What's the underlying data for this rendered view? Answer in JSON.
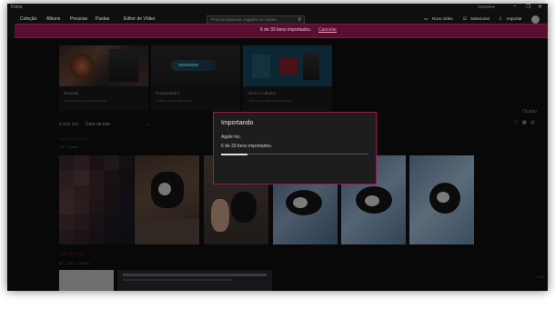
{
  "app": {
    "title": "Fotos",
    "onedrive": "OneDrive"
  },
  "window_controls": {
    "minimize": "–",
    "maximize": "❐",
    "close": "✕"
  },
  "nav": {
    "items": [
      "Coleção",
      "Álbuns",
      "Pessoas",
      "Pastas",
      "Editor de Vídeo"
    ]
  },
  "search": {
    "placeholder": "Procure pessoas, lugares ou coisas..."
  },
  "commands": {
    "new_video": "Novo vídeo",
    "select": "Selecionar",
    "import": "Importar"
  },
  "banner": {
    "text": "6 de 33 itens importados.",
    "link": "Cancelar"
  },
  "cards": [
    {
      "title": "Recente",
      "subtitle": "Adicionado na sua coleção"
    },
    {
      "title": "#computador",
      "subtitle": "Vídeos automatizados"
    },
    {
      "title": "Você é o diretor",
      "subtitle": "Criar um vídeo com música"
    }
  ],
  "filter": {
    "label": "Exibir por:",
    "value": "Data da foto",
    "hide": "Ocultar"
  },
  "groups": [
    {
      "date": "agosto de 2021",
      "sub": "1/8 · 6 itens"
    },
    {
      "date": "julho de 2021",
      "sub": "6/7 – 26/7 · 2 itens"
    }
  ],
  "timeline": {
    "year": "2021"
  },
  "dialog": {
    "title": "Importando",
    "source": "Apple Inc.",
    "status": "6 de 33 itens importados.",
    "progress": 0.18
  },
  "colors": {
    "accent": "#a0174f",
    "banner": "#5a0f31",
    "background": "#0f0f0f"
  }
}
